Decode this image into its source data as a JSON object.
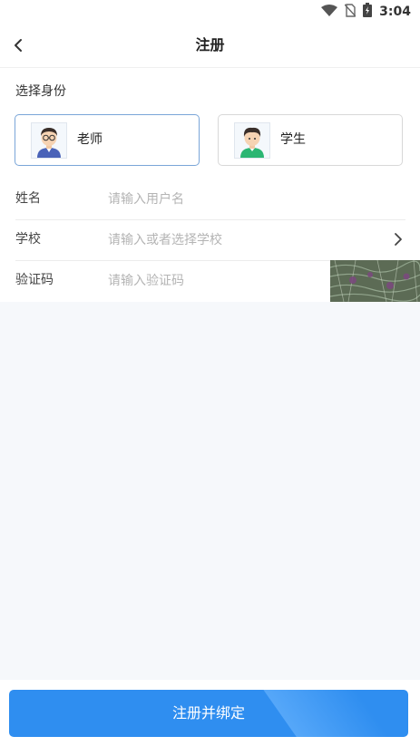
{
  "status_bar": {
    "time": "3:04",
    "icons": [
      "wifi-icon",
      "no-sim-icon",
      "battery-charging-icon"
    ]
  },
  "header": {
    "title": "注册",
    "back_icon": "chevron-left-icon"
  },
  "identity": {
    "label": "选择身份",
    "options": [
      {
        "label": "老师",
        "icon": "teacher-avatar-icon",
        "selected": true
      },
      {
        "label": "学生",
        "icon": "student-avatar-icon",
        "selected": false
      }
    ]
  },
  "form": {
    "name": {
      "label": "姓名",
      "placeholder": "请输入用户名",
      "value": ""
    },
    "school": {
      "label": "学校",
      "placeholder": "请输入或者选择学校",
      "value": "",
      "icon": "chevron-right-icon"
    },
    "captcha": {
      "label": "验证码",
      "placeholder": "请输入验证码",
      "value": "",
      "image": "captcha-image"
    }
  },
  "submit": {
    "label": "注册并绑定"
  },
  "colors": {
    "accent": "#2f8ef0",
    "selected_border": "#7aa6d8",
    "background": "#f6f8fb"
  }
}
